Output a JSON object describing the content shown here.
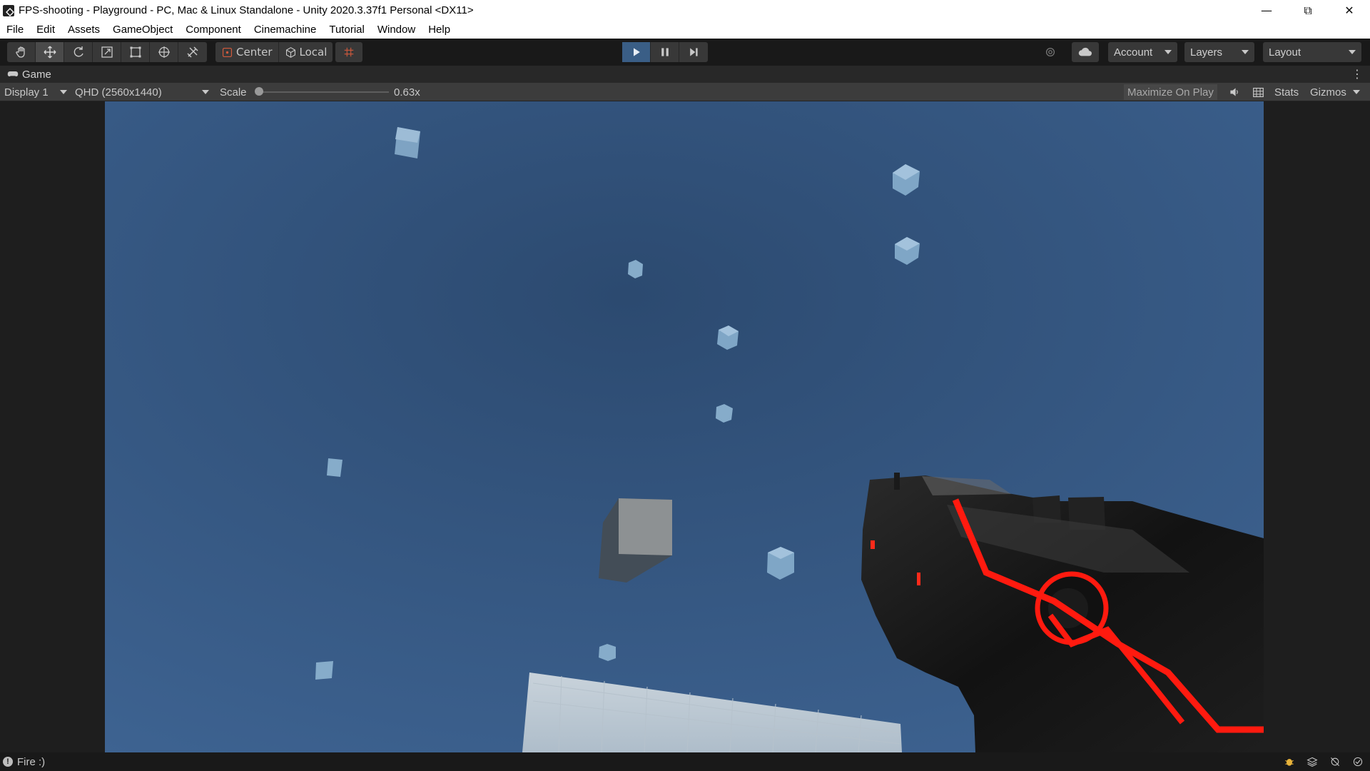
{
  "window": {
    "title": "FPS-shooting - Playground - PC, Mac & Linux Standalone - Unity 2020.3.37f1 Personal <DX11>",
    "controls": [
      "minimize",
      "restore",
      "close"
    ]
  },
  "menu": [
    "File",
    "Edit",
    "Assets",
    "GameObject",
    "Component",
    "Cinemachine",
    "Tutorial",
    "Window",
    "Help"
  ],
  "toolbar": {
    "tools": [
      "hand-tool",
      "move-tool",
      "rotate-tool",
      "scale-tool",
      "rect-tool",
      "transform-tool",
      "custom-tool"
    ],
    "active_tool": "move-tool",
    "pivot_label": "Center",
    "space_label": "Local",
    "account_label": "Account",
    "layers_label": "Layers",
    "layout_label": "Layout",
    "play_state": "playing"
  },
  "game_view": {
    "tab_label": "Game",
    "display_label": "Display 1",
    "resolution_label": "QHD (2560x1440)",
    "scale_label": "Scale",
    "scale_value": "0.63x",
    "maximize_label": "Maximize On Play",
    "stats_label": "Stats",
    "gizmos_label": "Gizmos"
  },
  "status": {
    "message": "Fire :)"
  },
  "colors": {
    "play_active": "#3a5e86",
    "sky_top": "#2f4c73",
    "sky_bottom": "#3d6393",
    "gun_accent": "#ff1a0f"
  }
}
